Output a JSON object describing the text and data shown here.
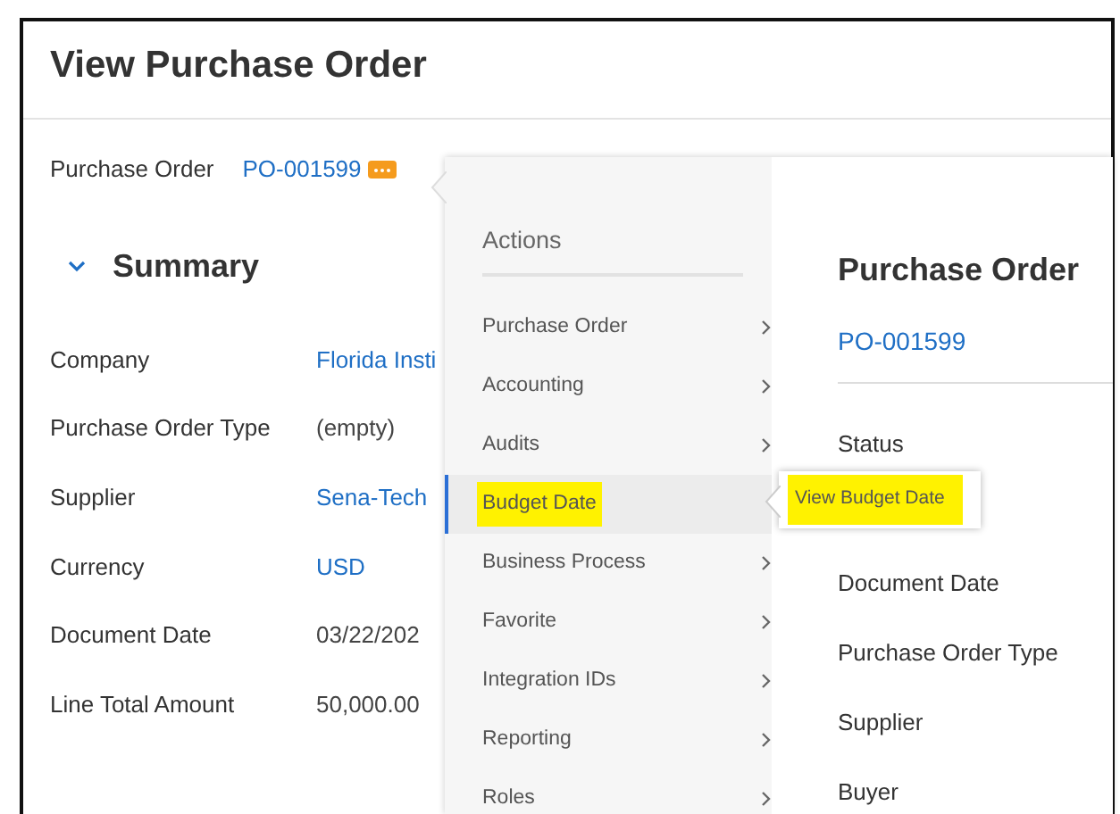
{
  "page": {
    "title": "View Purchase Order"
  },
  "header_field": {
    "label": "Purchase Order",
    "value": "PO-001599"
  },
  "section": {
    "title": "Summary",
    "expanded": true
  },
  "fields": [
    {
      "label": "Company",
      "value": "Florida Insti",
      "kind": "link"
    },
    {
      "label": "Purchase Order Type",
      "value": "(empty)",
      "kind": "text"
    },
    {
      "label": "Supplier",
      "value": "Sena-Tech",
      "kind": "link"
    },
    {
      "label": "Currency",
      "value": "USD",
      "kind": "link"
    },
    {
      "label": "Document Date",
      "value": "03/22/202",
      "kind": "text"
    },
    {
      "label": "Line Total Amount",
      "value": "50,000.00",
      "kind": "text"
    }
  ],
  "actions_menu": {
    "title": "Actions",
    "items": [
      {
        "label": "Purchase Order",
        "has_submenu": true,
        "selected": false,
        "highlighted": false
      },
      {
        "label": "Accounting",
        "has_submenu": true,
        "selected": false,
        "highlighted": false
      },
      {
        "label": "Audits",
        "has_submenu": true,
        "selected": false,
        "highlighted": false
      },
      {
        "label": "Budget Date",
        "has_submenu": false,
        "selected": true,
        "highlighted": true
      },
      {
        "label": "Business Process",
        "has_submenu": true,
        "selected": false,
        "highlighted": false
      },
      {
        "label": "Favorite",
        "has_submenu": true,
        "selected": false,
        "highlighted": false
      },
      {
        "label": "Integration IDs",
        "has_submenu": true,
        "selected": false,
        "highlighted": false
      },
      {
        "label": "Reporting",
        "has_submenu": true,
        "selected": false,
        "highlighted": false
      },
      {
        "label": "Roles",
        "has_submenu": true,
        "selected": false,
        "highlighted": false
      }
    ]
  },
  "submenu": {
    "items": [
      {
        "label": "View Budget Date",
        "highlighted": true
      }
    ]
  },
  "preview": {
    "title": "Purchase Order",
    "link": "PO-001599",
    "labels": [
      "Status",
      "Document Date",
      "Purchase Order Type",
      "Supplier",
      "Buyer"
    ]
  }
}
